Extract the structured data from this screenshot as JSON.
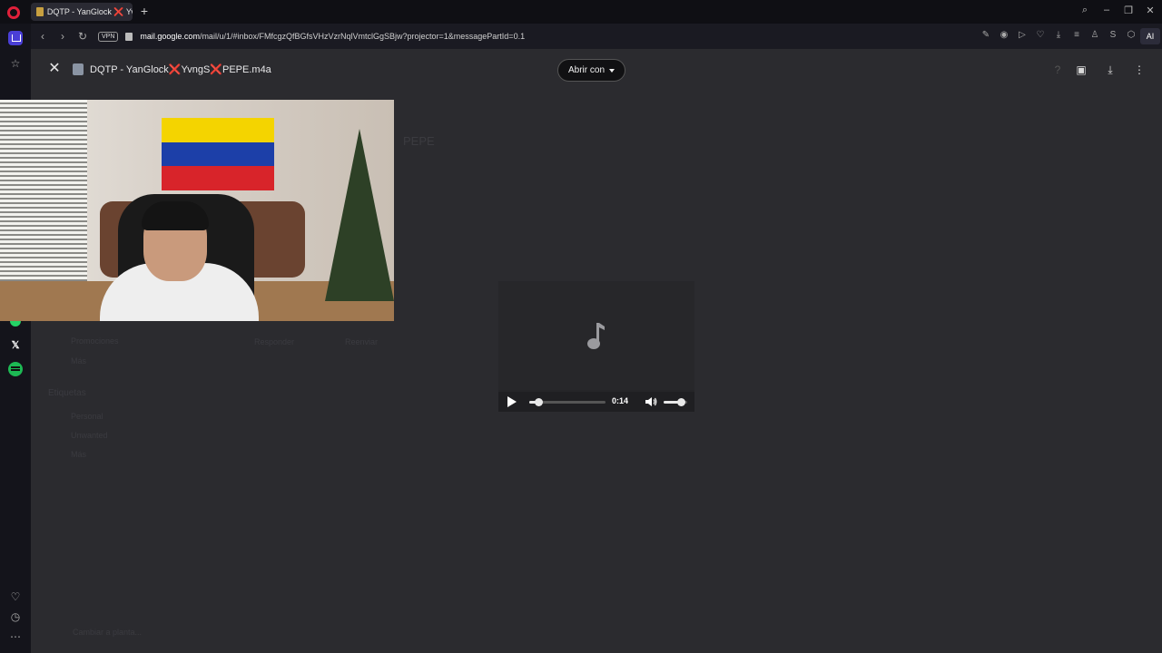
{
  "tab": {
    "title": "DQTP - YanGlock ❌ Yvng"
  },
  "address": {
    "vpn_label": "VPN",
    "host": "mail.google.com",
    "path": "/mail/u/1/#inbox/FMfcgzQfBGfsVHzVzrNqlVmtclGgSBjw?projector=1&messagePartId=0.1"
  },
  "ai_label": "AI",
  "viewer": {
    "file_name": "DQTP - YanGlock❌YvngS❌PEPE.m4a",
    "open_with_label": "Abrir con"
  },
  "player": {
    "current_time": "0:14",
    "progress": 0.12,
    "volume": 0.72
  },
  "background_gmail": {
    "subject_fragment": "PEPE",
    "sidebar_items": [
      "Promociones",
      "Más"
    ],
    "labels_heading": "Etiquetas",
    "label_items": [
      "Personal",
      "Unwanted",
      "Más"
    ],
    "footer_hint": "Cambiar a planta...",
    "action_reply": "Responder",
    "action_forward": "Reenviar"
  }
}
